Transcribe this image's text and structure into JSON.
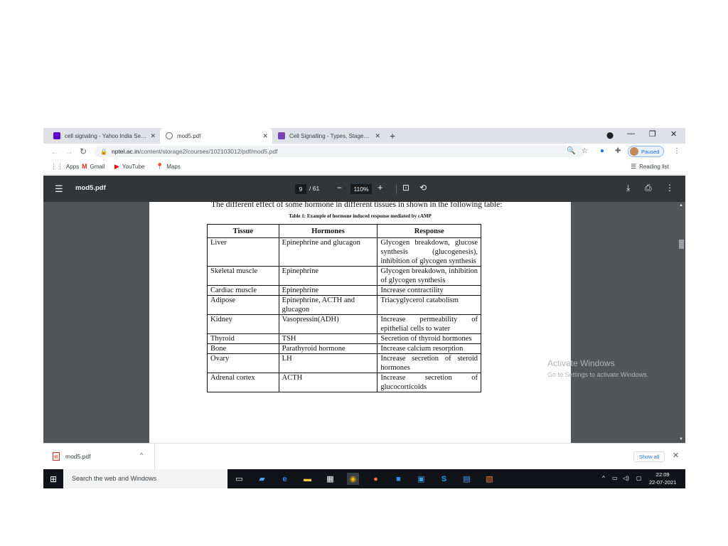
{
  "browser": {
    "tabs": [
      {
        "title": "cell signaling - Yahoo India Search",
        "favicon_color": "#6001d2"
      },
      {
        "title": "mod5.pdf",
        "favicon_color": "#5f6368"
      },
      {
        "title": "Cell Signalling - Types, Stages & Functions",
        "favicon_color": "#7b3fb0"
      }
    ],
    "url": {
      "host": "nptel.ac.in",
      "path": "/content/storage2/courses/102103012/pdf/mod5.pdf"
    },
    "profile_label": "Paused",
    "bookmarks": [
      "Apps",
      "Gmail",
      "YouTube",
      "Maps"
    ],
    "reading_list": "Reading list"
  },
  "pdf_viewer": {
    "file_name": "mod5.pdf",
    "current_page": "9",
    "total_pages": "/ 61",
    "zoom": "110%"
  },
  "document": {
    "intro_text": "The different effect of some hormone in different tissues in shown in the following table:",
    "table_caption": "Table 1: Example of hormone induced response mediated by cAMP",
    "columns": [
      "Tissue",
      "Hormones",
      "Response"
    ],
    "rows": [
      [
        "Liver",
        "Epinephrine and glucagon",
        "Glycogen breakdown, glucose synthesis (glucogenesis), inhibition of glycogen synthesis"
      ],
      [
        "Skeletal muscle",
        "Epinephrine",
        "Glycogen breakdown, inhibition of glycogen synthesis"
      ],
      [
        "Cardiac muscle",
        "Epinephrine",
        "Increase contractility"
      ],
      [
        "Adipose",
        "Epinephrine, ACTH and glucagon",
        "Triacyglycerol catabolism"
      ],
      [
        "Kidney",
        "Vasopressin(ADH)",
        "Increase permeability of epithelial cells to water"
      ],
      [
        "Thyroid",
        "TSH",
        "Secretion of thyroid hormones"
      ],
      [
        "Bone",
        "Parathyroid hormone",
        "Increase calcium resorption"
      ],
      [
        "Ovary",
        "LH",
        "Increase secretion of steroid hormones"
      ],
      [
        "Adrenal cortex",
        "ACTH",
        "Increase secretion of glucocorticoids"
      ]
    ]
  },
  "watermark": {
    "line1": "Activate Windows",
    "line2": "Go to Settings to activate Windows."
  },
  "downloads": {
    "file": "mod5.pdf",
    "show_all": "Show all"
  },
  "taskbar": {
    "search_placeholder": "Search the web and Windows",
    "time": "22:09",
    "date": "22-07-2021"
  }
}
